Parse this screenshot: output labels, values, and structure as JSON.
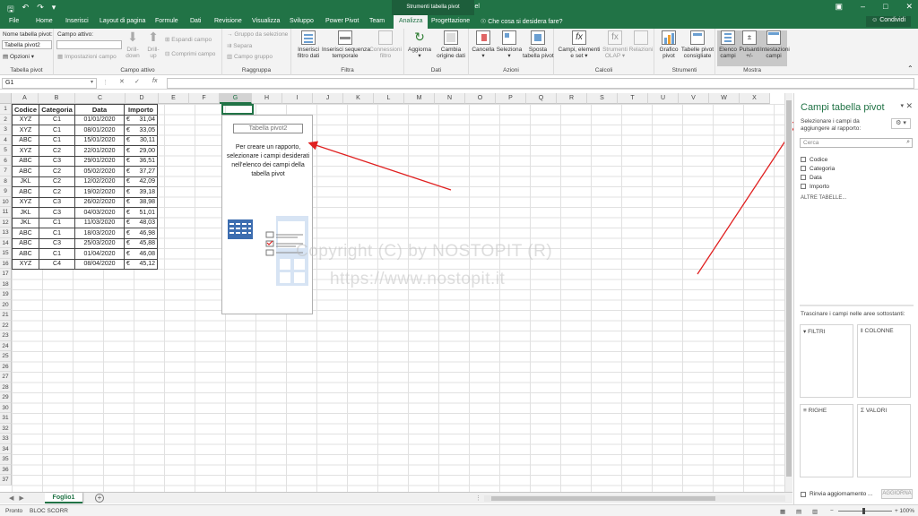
{
  "window": {
    "title": "Cartel2 - Excel",
    "context_tab_group": "Strumenti tabella pivot",
    "share_label": "Condividi"
  },
  "tabs": [
    "File",
    "Home",
    "Inserisci",
    "Layout di pagina",
    "Formule",
    "Dati",
    "Revisione",
    "Visualizza",
    "Sviluppo",
    "Power Pivot",
    "Team",
    "Analizza",
    "Progettazione"
  ],
  "active_tab": "Analizza",
  "tell_me": "Che cosa si desidera fare?",
  "ribbon": {
    "pivot": {
      "name_label": "Nome tabella pivot:",
      "name_value": "Tabella pivot2",
      "options": "Opzioni",
      "group": "Tabella pivot"
    },
    "active_field": {
      "label": "Campo attivo:",
      "settings": "Impostazioni campo",
      "drill_down": "Drill-\ndown",
      "drill_up": "Drill-\nup",
      "expand": "Espandi campo",
      "collapse": "Comprimi campo",
      "group": "Campo attivo"
    },
    "grouping": {
      "selection": "Gruppo da selezione",
      "ungroup": "Separa",
      "field": "Campo gruppo",
      "group": "Raggruppa"
    },
    "filter": {
      "slicer": "Inserisci\nfiltro dati",
      "timeline": "Inserisci sequenza\ntemporale",
      "connections": "Connessioni\nfiltro",
      "group": "Filtra"
    },
    "data": {
      "refresh": "Aggiorna",
      "change_source": "Cambia\norigine dati",
      "group": "Dati"
    },
    "actions": {
      "clear": "Cancella",
      "select": "Seleziona",
      "move": "Sposta\ntabella pivot",
      "group": "Azioni"
    },
    "calculations": {
      "fields": "Campi, elementi\ne set",
      "olap": "Strumenti\nOLAP",
      "relations": "Relazioni",
      "group": "Calcoli"
    },
    "tools": {
      "chart": "Grafico\npivot",
      "recommended": "Tabelle pivot\nconsigliate",
      "group": "Strumenti"
    },
    "show": {
      "field_list": "Elenco\ncampi",
      "buttons": "Pulsanti\n+/-",
      "headers": "Intestazioni\ncampi",
      "group": "Mostra"
    }
  },
  "formula_bar": {
    "name_box": "G1",
    "fx": "fx",
    "value": ""
  },
  "columns": [
    "A",
    "B",
    "C",
    "D",
    "E",
    "F",
    "G",
    "H",
    "I",
    "J",
    "K",
    "L",
    "M",
    "N",
    "O",
    "P",
    "Q",
    "R",
    "S",
    "T",
    "U",
    "V",
    "W",
    "X"
  ],
  "selected_column": "G",
  "table": {
    "headers": [
      "Codice",
      "Categoria",
      "Data",
      "Importo"
    ],
    "currency": "€",
    "rows": [
      [
        "XYZ",
        "C1",
        "01/01/2020",
        "31,04"
      ],
      [
        "XYZ",
        "C1",
        "08/01/2020",
        "33,05"
      ],
      [
        "ABC",
        "C1",
        "15/01/2020",
        "30,11"
      ],
      [
        "XYZ",
        "C2",
        "22/01/2020",
        "29,00"
      ],
      [
        "ABC",
        "C3",
        "29/01/2020",
        "36,51"
      ],
      [
        "ABC",
        "C2",
        "05/02/2020",
        "37,27"
      ],
      [
        "JKL",
        "C2",
        "12/02/2020",
        "42,09"
      ],
      [
        "ABC",
        "C2",
        "19/02/2020",
        "39,18"
      ],
      [
        "XYZ",
        "C3",
        "26/02/2020",
        "38,98"
      ],
      [
        "JKL",
        "C3",
        "04/03/2020",
        "51,01"
      ],
      [
        "JKL",
        "C1",
        "11/03/2020",
        "48,03"
      ],
      [
        "ABC",
        "C1",
        "18/03/2020",
        "46,98"
      ],
      [
        "ABC",
        "C3",
        "25/03/2020",
        "45,88"
      ],
      [
        "ABC",
        "C1",
        "01/04/2020",
        "46,08"
      ],
      [
        "XYZ",
        "C4",
        "08/04/2020",
        "45,12"
      ]
    ]
  },
  "pivot_placeholder": {
    "name": "Tabella pivot2",
    "message": "Per creare un rapporto, selezionare i campi desiderati nell'elenco dei campi della tabella pivot"
  },
  "watermark": {
    "line1": "Copyright (C) by NOSTOPIT (R)",
    "line2": "https://www.nostopit.it"
  },
  "sheet": {
    "tab": "Foglio1",
    "add": "+"
  },
  "status": {
    "ready": "Pronto",
    "scroll_lock": "BLOC SCORR",
    "zoom": "100%"
  },
  "field_pane": {
    "title": "Campi tabella pivot",
    "subtitle": "Selezionare i campi da aggiungere al rapporto:",
    "search_placeholder": "Cerca",
    "fields": [
      "Codice",
      "Categoria",
      "Data",
      "Importo"
    ],
    "more_tables": "ALTRE TABELLE...",
    "drag_hint": "Trascinare i campi nelle aree sottostanti:",
    "areas": [
      "FILTRI",
      "COLONNE",
      "RIGHE",
      "VALORI"
    ],
    "defer": "Rinvia aggiornamento ...",
    "update": "AGGIORNA"
  },
  "colors": {
    "excel_green": "#217346",
    "annotation_red": "#e02020"
  }
}
